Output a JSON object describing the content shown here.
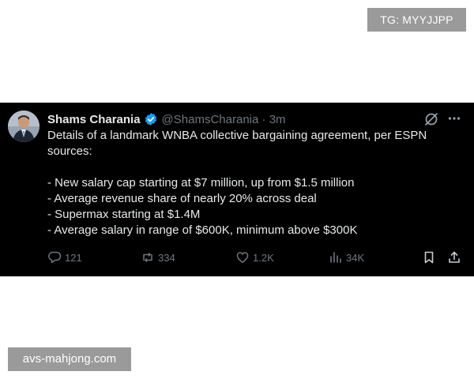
{
  "watermarks": {
    "top": "TG: MYYJJPP",
    "bottom": "avs-mahjong.com"
  },
  "tweet": {
    "author_name": "Shams Charania",
    "handle": "@ShamsCharania",
    "separator": "·",
    "time": "3m",
    "verified": true,
    "text_lines": [
      "Details of a landmark WNBA collective bargaining agreement, per ESPN",
      "sources:",
      "",
      "- New salary cap starting at $7 million, up from $1.5 million",
      "- Average revenue share of nearly 20% across deal",
      "- Supermax starting at $1.4M",
      "- Average salary in range of $600K, minimum above $300K"
    ],
    "metrics": {
      "replies": "121",
      "reposts": "334",
      "likes": "1.2K",
      "views": "34K"
    }
  },
  "icons": {
    "verified": "verified-badge-icon",
    "grok": "grok-icon",
    "more": "more-icon",
    "reply": "reply-icon",
    "repost": "repost-icon",
    "like": "like-icon",
    "views": "views-icon",
    "bookmark": "bookmark-icon",
    "share": "share-icon"
  },
  "colors": {
    "card_background": "#000000",
    "text_primary": "#e7e9ea",
    "text_secondary": "#71767b",
    "verified_blue": "#1d9bf0",
    "watermark_bg": "#9a9a9a"
  }
}
